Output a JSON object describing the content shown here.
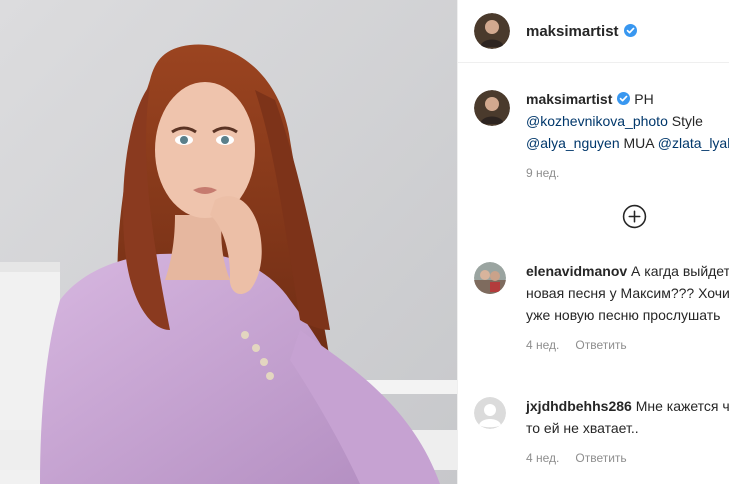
{
  "post": {
    "author": {
      "username": "maksimartist",
      "verified": true
    },
    "caption": {
      "prefix": "PH",
      "mention_photo": "@kozhevnikova_photo",
      "style_label": "Style",
      "mention_style": "@alya_nguyen",
      "mua_label": "MUA",
      "mention_mua": "@zlata_lyal",
      "time": "9 нед."
    },
    "load_more_icon": "plus-circle-icon",
    "comments": [
      {
        "username": "elenavidmanov",
        "text": "А кагда выйдет новая песня у Максим??? Хочица уже новую песню прослушать",
        "time": "4 нед.",
        "reply": "Ответить",
        "avatar_icon": "user-photo-avatar"
      },
      {
        "username": "jxjdhdbehhs286",
        "text": "Мне кажется что-то ей не хватает..",
        "time": "4 нед.",
        "reply": "Ответить",
        "avatar_icon": "default-avatar-icon"
      }
    ]
  },
  "colors": {
    "verified_badge": "#3897f0",
    "mention": "#00376b",
    "muted": "#8e8e8e",
    "hair": "#8a3a1f",
    "suit": "#c9a6d4",
    "background": "#d3d4d6"
  }
}
